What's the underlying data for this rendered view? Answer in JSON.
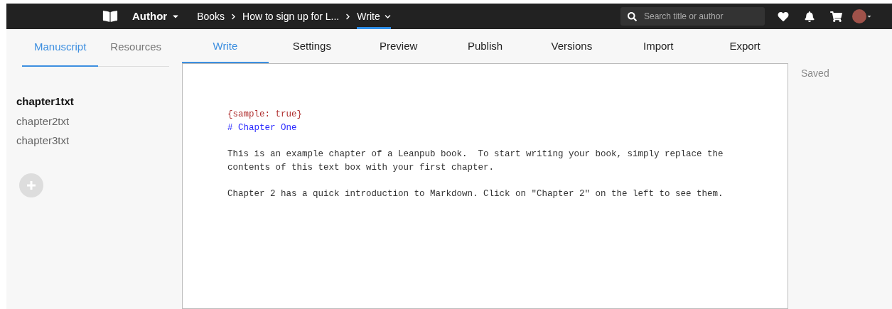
{
  "topbar": {
    "menu": "Author",
    "breadcrumbs": [
      {
        "label": "Books",
        "selected": false
      },
      {
        "label": "How to sign up for L...",
        "selected": false
      },
      {
        "label": "Write",
        "selected": true
      }
    ],
    "search": {
      "placeholder": "Search title or author"
    }
  },
  "sidebar": {
    "tabs": [
      {
        "label": "Manuscript",
        "selected": true
      },
      {
        "label": "Resources",
        "selected": false
      }
    ],
    "chapters": [
      {
        "label": "chapter1txt",
        "selected": true
      },
      {
        "label": "chapter2txt",
        "selected": false
      },
      {
        "label": "chapter3txt",
        "selected": false
      }
    ]
  },
  "tabs": [
    {
      "label": "Write",
      "selected": true
    },
    {
      "label": "Settings",
      "selected": false
    },
    {
      "label": "Preview",
      "selected": false
    },
    {
      "label": "Publish",
      "selected": false
    },
    {
      "label": "Versions",
      "selected": false
    },
    {
      "label": "Import",
      "selected": false
    },
    {
      "label": "Export",
      "selected": false
    }
  ],
  "status": "Saved",
  "editor": {
    "lines": [
      {
        "kind": "meta",
        "text": "{sample: true}"
      },
      {
        "kind": "heading",
        "text": "# Chapter One"
      },
      {
        "kind": "paragraph",
        "text": "This is an example chapter of a Leanpub book.  To start writing your book, simply replace the contents of this text box with your first chapter."
      },
      {
        "kind": "paragraph",
        "text": "Chapter 2 has a quick introduction to Markdown. Click on \"Chapter 2\" on the left to see them."
      }
    ]
  }
}
